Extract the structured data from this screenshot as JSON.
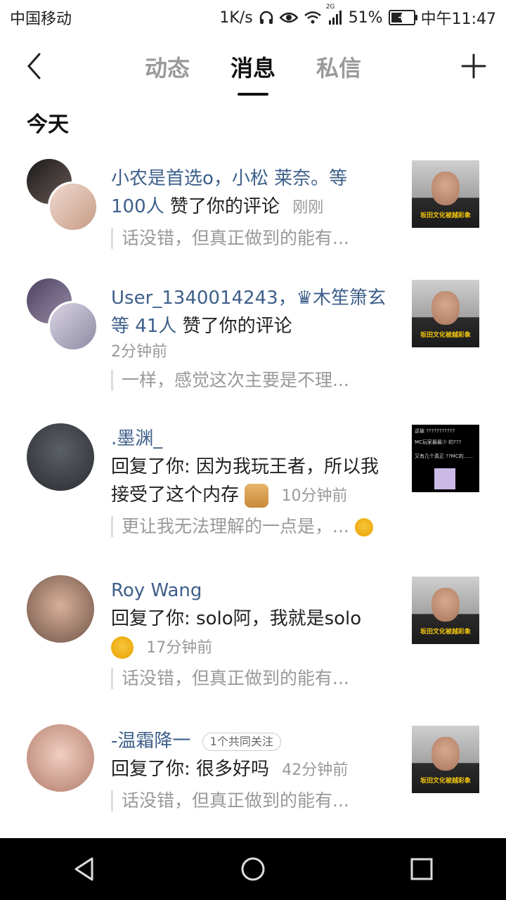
{
  "status_bar": {
    "carrier": "中国移动",
    "speed": "1K/s",
    "signal_tag": "2G",
    "battery": "51%",
    "battery_level": 0.51,
    "time": "中午11:47"
  },
  "header": {
    "tabs": [
      {
        "label": "动态",
        "active": false
      },
      {
        "label": "消息",
        "active": true
      },
      {
        "label": "私信",
        "active": false
      }
    ]
  },
  "section_title": "今天",
  "items": [
    {
      "names": "小农是首选o，小松 莱奈。等",
      "count": "100人",
      "action": "赞了你的评论",
      "time": "刚刚",
      "quote": "话没错，但真正做到的能有...",
      "thumb_caption": "坂田文化被越彩象"
    },
    {
      "names": "User_1340014243，♛木笙箫玄",
      "count": "等 41人",
      "action": "赞了你的评论",
      "time": "2分钟前",
      "quote": "一样，感觉这次主要是不理...",
      "thumb_caption": "坂田文化被越彩象"
    },
    {
      "names": ".墨渊_",
      "action": "回复了你: 因为我玩王者，所以我接受了这个内存",
      "time": "10分钟前",
      "quote": "更让我无法理解的一点是，...",
      "thumb_lines": [
        "这破 ???????????",
        "MC玩家最最少 的???",
        "又有几个真正 ??MC的......"
      ]
    },
    {
      "names": "Roy Wang",
      "action": "回复了你: solo阿，我就是solo",
      "time": "17分钟前",
      "quote": "话没错，但真正做到的能有...",
      "thumb_caption": "坂田文化被越彩象"
    },
    {
      "names": "-温霜降一",
      "badge": "1个共同关注",
      "action": "回复了你: 很多好吗",
      "time": "42分钟前",
      "quote": "话没错，但真正做到的能有...",
      "thumb_caption": "坂田文化被越彩象"
    }
  ]
}
